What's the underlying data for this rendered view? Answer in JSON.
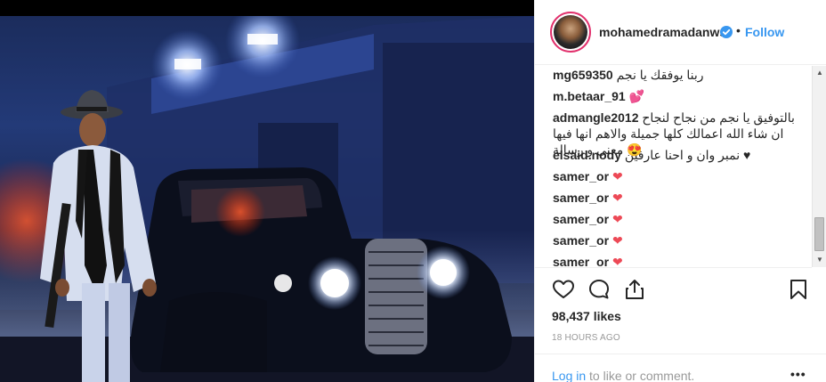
{
  "post": {
    "username": "mohamedramadanws",
    "follow_label": "Follow",
    "separator": "•"
  },
  "comments": [
    {
      "user": "mg659350",
      "text": "ربنا يوفقك يا نجم"
    },
    {
      "user": "m.betaar_91",
      "text": "💕"
    },
    {
      "user": "admangle2012",
      "text": "بالتوفيق يا نجم من نجاح لنجاح ان شاء الله اعمالك كلها جميلة والاهم انها فيها معنى و رسالة 😍"
    },
    {
      "user": "elsaid.nody",
      "text": "نمبر وان و احنا عارفين ♥"
    },
    {
      "user": "samer_or",
      "text": "❤"
    },
    {
      "user": "samer_or",
      "text": "❤"
    },
    {
      "user": "samer_or",
      "text": "❤"
    },
    {
      "user": "samer_or",
      "text": "❤"
    },
    {
      "user": "samer_or",
      "text": "❤"
    }
  ],
  "stats": {
    "likes": "98,437 likes",
    "time": "18 HOURS AGO"
  },
  "footer": {
    "login_link": "Log in",
    "login_rest": " to like or comment.",
    "more": "•••"
  },
  "icons": {
    "like": "heart-outline-icon",
    "comment": "speech-bubble-icon",
    "share": "share-icon",
    "save": "bookmark-icon",
    "verified": "verified-badge-icon"
  },
  "colors": {
    "accent": "#3897f0",
    "heart": "#ed4956",
    "story_ring": "#e1306c"
  }
}
